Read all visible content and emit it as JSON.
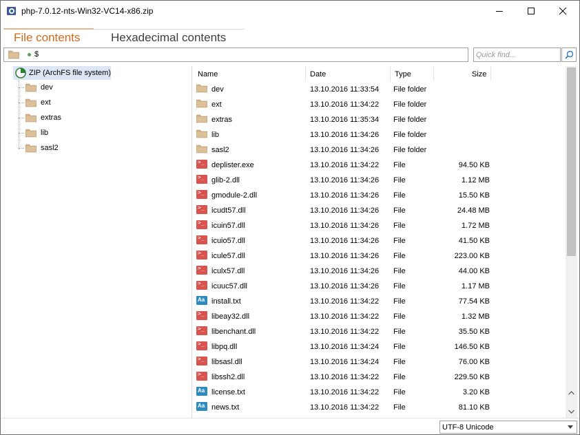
{
  "window": {
    "title": "php-7.0.12-nts-Win32-VC14-x86.zip",
    "buttons": [
      "minimize",
      "maximize",
      "close"
    ]
  },
  "tabs": [
    {
      "label": "File contents",
      "active": true
    },
    {
      "label": "Hexadecimal contents",
      "active": false
    }
  ],
  "path": {
    "text": "$"
  },
  "quick_find": {
    "placeholder": "Quick find..."
  },
  "tree": {
    "root": "ZIP (ArchFS file system)",
    "items": [
      "dev",
      "ext",
      "extras",
      "lib",
      "sasl2"
    ]
  },
  "columns": {
    "name": "Name",
    "date": "Date",
    "type": "Type",
    "size": "Size"
  },
  "files": [
    {
      "name": "dev",
      "date": "13.10.2016 11:33:54",
      "type": "File folder",
      "size": "",
      "icon": "folder-icon"
    },
    {
      "name": "ext",
      "date": "13.10.2016 11:34:22",
      "type": "File folder",
      "size": "",
      "icon": "folder-icon"
    },
    {
      "name": "extras",
      "date": "13.10.2016 11:35:34",
      "type": "File folder",
      "size": "",
      "icon": "folder-icon"
    },
    {
      "name": "lib",
      "date": "13.10.2016 11:34:26",
      "type": "File folder",
      "size": "",
      "icon": "folder-icon"
    },
    {
      "name": "sasl2",
      "date": "13.10.2016 11:34:26",
      "type": "File folder",
      "size": "",
      "icon": "folder-icon"
    },
    {
      "name": "deplister.exe",
      "date": "13.10.2016 11:34:22",
      "type": "File",
      "size": "94.50 KB",
      "icon": "executable-icon"
    },
    {
      "name": "glib-2.dll",
      "date": "13.10.2016 11:34:26",
      "type": "File",
      "size": "1.12 MB",
      "icon": "executable-icon"
    },
    {
      "name": "gmodule-2.dll",
      "date": "13.10.2016 11:34:26",
      "type": "File",
      "size": "15.50 KB",
      "icon": "executable-icon"
    },
    {
      "name": "icudt57.dll",
      "date": "13.10.2016 11:34:26",
      "type": "File",
      "size": "24.48 MB",
      "icon": "executable-icon"
    },
    {
      "name": "icuin57.dll",
      "date": "13.10.2016 11:34:26",
      "type": "File",
      "size": "1.72 MB",
      "icon": "executable-icon"
    },
    {
      "name": "icuio57.dll",
      "date": "13.10.2016 11:34:26",
      "type": "File",
      "size": "41.50 KB",
      "icon": "executable-icon"
    },
    {
      "name": "icule57.dll",
      "date": "13.10.2016 11:34:26",
      "type": "File",
      "size": "223.00 KB",
      "icon": "executable-icon"
    },
    {
      "name": "iculx57.dll",
      "date": "13.10.2016 11:34:26",
      "type": "File",
      "size": "44.00 KB",
      "icon": "executable-icon"
    },
    {
      "name": "icuuc57.dll",
      "date": "13.10.2016 11:34:26",
      "type": "File",
      "size": "1.17 MB",
      "icon": "executable-icon"
    },
    {
      "name": "install.txt",
      "date": "13.10.2016 11:34:22",
      "type": "File",
      "size": "77.54 KB",
      "icon": "text-file-icon"
    },
    {
      "name": "libeay32.dll",
      "date": "13.10.2016 11:34:22",
      "type": "File",
      "size": "1.32 MB",
      "icon": "executable-icon"
    },
    {
      "name": "libenchant.dll",
      "date": "13.10.2016 11:34:22",
      "type": "File",
      "size": "35.50 KB",
      "icon": "executable-icon"
    },
    {
      "name": "libpq.dll",
      "date": "13.10.2016 11:34:24",
      "type": "File",
      "size": "146.50 KB",
      "icon": "executable-icon"
    },
    {
      "name": "libsasl.dll",
      "date": "13.10.2016 11:34:24",
      "type": "File",
      "size": "76.00 KB",
      "icon": "executable-icon"
    },
    {
      "name": "libssh2.dll",
      "date": "13.10.2016 11:34:22",
      "type": "File",
      "size": "229.50 KB",
      "icon": "executable-icon"
    },
    {
      "name": "license.txt",
      "date": "13.10.2016 11:34:22",
      "type": "File",
      "size": "3.20 KB",
      "icon": "text-file-icon"
    },
    {
      "name": "news.txt",
      "date": "13.10.2016 11:34:22",
      "type": "File",
      "size": "81.10 KB",
      "icon": "text-file-icon"
    }
  ],
  "status": {
    "encoding": "UTF-8 Unicode"
  },
  "colors": {
    "accent_tab": "#d2691e",
    "selection": "#dce6f4",
    "exe_icon": "#d9534f",
    "txt_icon": "#2e8bc0",
    "folder": "#d4b48a"
  }
}
